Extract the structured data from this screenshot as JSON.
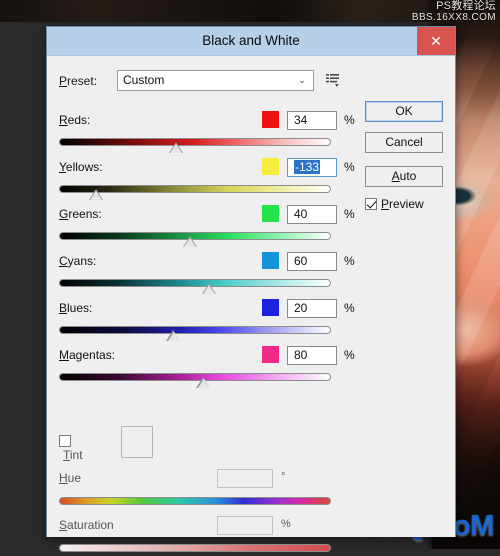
{
  "app": {
    "workspace_bg": "#2b2b2b",
    "watermark_top_line1": "PS教程论坛",
    "watermark_top_line2": "BBS.16XX8.COM",
    "watermark_bottom": "UiBQ.CoM",
    "watermark_bottom_color": "#1667d8"
  },
  "dialog": {
    "title": "Black and White",
    "close_label": "✕",
    "close_color": "#d9534f",
    "titlebar_color": "#b6d0ea"
  },
  "preset": {
    "label": "Preset:",
    "value": "Custom",
    "arrow": "⌄",
    "menu_icon": "preset-options-icon"
  },
  "buttons": {
    "ok": "OK",
    "cancel": "Cancel",
    "auto": "Auto",
    "preview_label": "Preview",
    "preview_checked": true
  },
  "channels": [
    {
      "name": "Reds:",
      "value": "34",
      "unit": "%",
      "swatch": "#ee1111",
      "thumb_pct": 43.0,
      "selected": false,
      "gradient": "linear-gradient(90deg,#000000 0%,#7d0d0d 28%,#d81f1f 50%,#ef6a6a 66%,#f6b9b9 82%,#ffffff 100%)"
    },
    {
      "name": "Yellows:",
      "value": "-133",
      "unit": "%",
      "swatch": "#f5ec3d",
      "thumb_pct": 13.5,
      "selected": true,
      "gradient": "linear-gradient(90deg,#000000 0%,#2a2a12 18%,#8a8a3a 42%,#d6d45c 62%,#ecea8f 78%,#ffffff 100%)"
    },
    {
      "name": "Greens:",
      "value": "40",
      "unit": "%",
      "swatch": "#24e24a",
      "thumb_pct": 48.0,
      "selected": false,
      "gradient": "linear-gradient(90deg,#000000 0%,#0a3a1c 22%,#1c9a45 46%,#26e05c 62%,#88f0a8 80%,#ffffff 100%)"
    },
    {
      "name": "Cyans:",
      "value": "60",
      "unit": "%",
      "swatch": "#1393d8",
      "thumb_pct": 55.0,
      "selected": false,
      "gradient": "linear-gradient(90deg,#000000 0%,#0a3238 22%,#1f8f96 46%,#49c9c9 60%,#a5e6e6 80%,#ffffff 100%)"
    },
    {
      "name": "Blues:",
      "value": "20",
      "unit": "%",
      "swatch": "#1a22e0",
      "thumb_pct": 42.0,
      "selected": false,
      "gradient": "linear-gradient(90deg,#000000 0%,#0c0c40 24%,#2222b8 46%,#4b4bf0 60%,#a9a9f2 80%,#ffffff 100%)"
    },
    {
      "name": "Magentas:",
      "value": "80",
      "unit": "%",
      "swatch": "#f02a86",
      "thumb_pct": 53.0,
      "selected": false,
      "gradient": "linear-gradient(90deg,#000000 0%,#3a0a32 22%,#a81f96 44%,#e84ae0 60%,#f0a8ee 80%,#ffffff 100%)"
    }
  ],
  "tint": {
    "label": "Tint",
    "checked": false,
    "swatch_color": "#efefef"
  },
  "hue": {
    "label": "Hue",
    "value": "",
    "unit": "°",
    "gradient": "linear-gradient(90deg,#d94b2a 0%,#d9a02a 10%,#c8d42a 19%,#4ec83c 31%,#2ec8a8 44%,#2a8fd9 58%,#2f2fd0 68%,#9a2fd0 80%,#d92a9a 90%,#d94b3a 100%)"
  },
  "saturation": {
    "label": "Saturation",
    "value": "",
    "unit": "%",
    "gradient": "linear-gradient(90deg,#f4f0f0 0%,#eccfcf 20%,#e0a8a8 45%,#d87474 70%,#d24a4a 100%)"
  }
}
